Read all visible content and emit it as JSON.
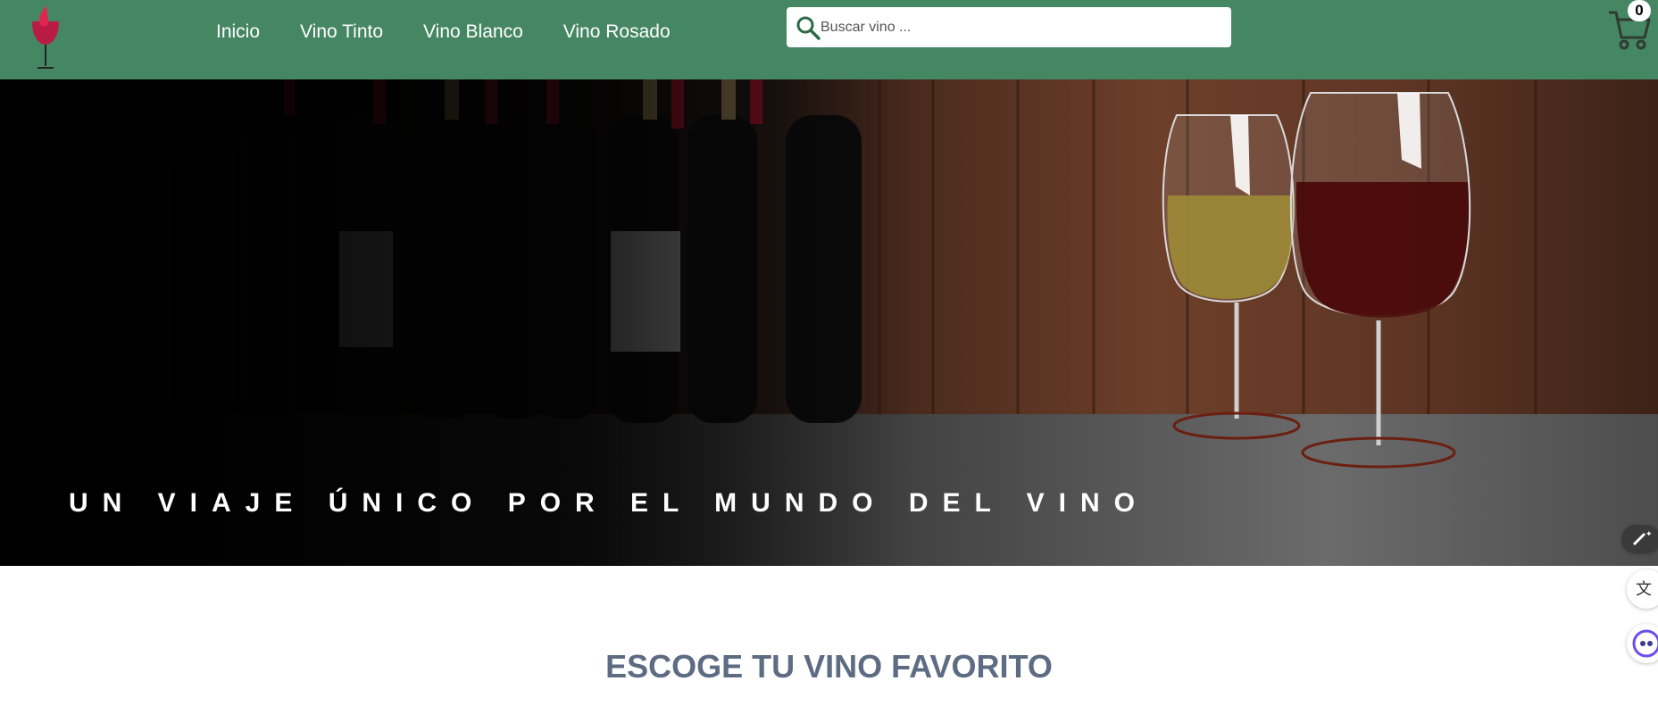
{
  "nav": {
    "links": [
      "Inicio",
      "Vino Tinto",
      "Vino Blanco",
      "Vino Rosado"
    ],
    "search_placeholder": "Buscar vino ...",
    "cart_count": "0",
    "logo_icon": "wine-glass-icon",
    "search_icon": "search-icon",
    "cart_icon": "shopping-cart-icon"
  },
  "hero": {
    "title": "UN VIAJE ÚNICO POR EL MUNDO DEL VINO"
  },
  "section": {
    "title": "ESCOGE TU VINO FAVORITO"
  },
  "side_tools": [
    "magic-wand-icon",
    "translate-icon",
    "chat-assistant-icon"
  ],
  "colors": {
    "navbar": "#468763",
    "section_title": "#5d6c82",
    "white": "#ffffff"
  }
}
